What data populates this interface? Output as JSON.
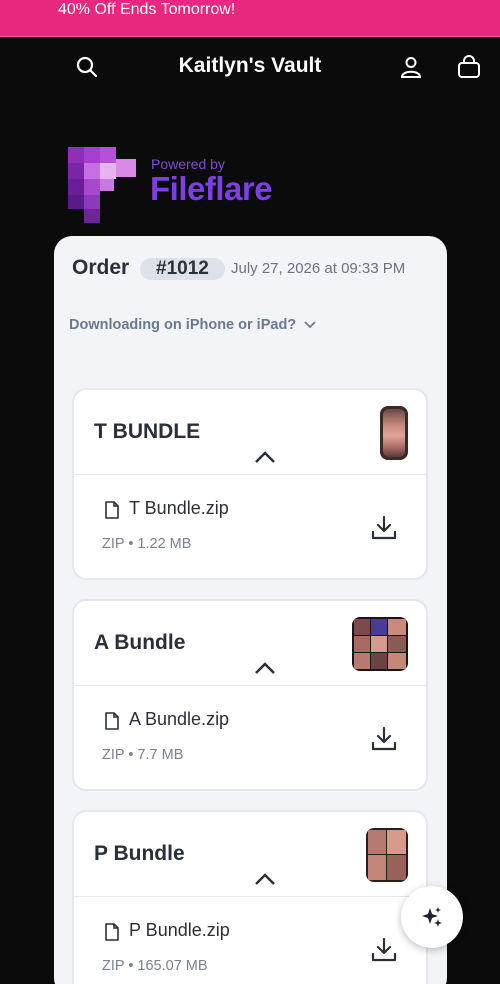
{
  "promo": {
    "text": "40% Off Ends Tomorrow!"
  },
  "header": {
    "title": "Kaitlyn's Vault",
    "icons": [
      "search-icon",
      "account-icon",
      "shopping-bag-icon"
    ]
  },
  "logo": {
    "powered_by": "Powered by",
    "brand": "Fileflare"
  },
  "order": {
    "label": "Order",
    "number": "#1012",
    "date": "July 27, 2026 at 09:33 PM"
  },
  "download_hint": "Downloading on iPhone or iPad?",
  "bundles": [
    {
      "name": "T BUNDLE",
      "file": "T Bundle.zip",
      "meta": "ZIP • 1.22 MB"
    },
    {
      "name": "A Bundle",
      "file": "A Bundle.zip",
      "meta": "ZIP • 7.7 MB"
    },
    {
      "name": "P Bundle",
      "file": "P Bundle.zip",
      "meta": "ZIP • 165.07 MB"
    }
  ],
  "colors": {
    "promo_bg": "#e8287f",
    "page_bg": "#0b0b0b",
    "brand_purple": "#7c3fe0",
    "panel_bg": "#f3f4f8"
  }
}
